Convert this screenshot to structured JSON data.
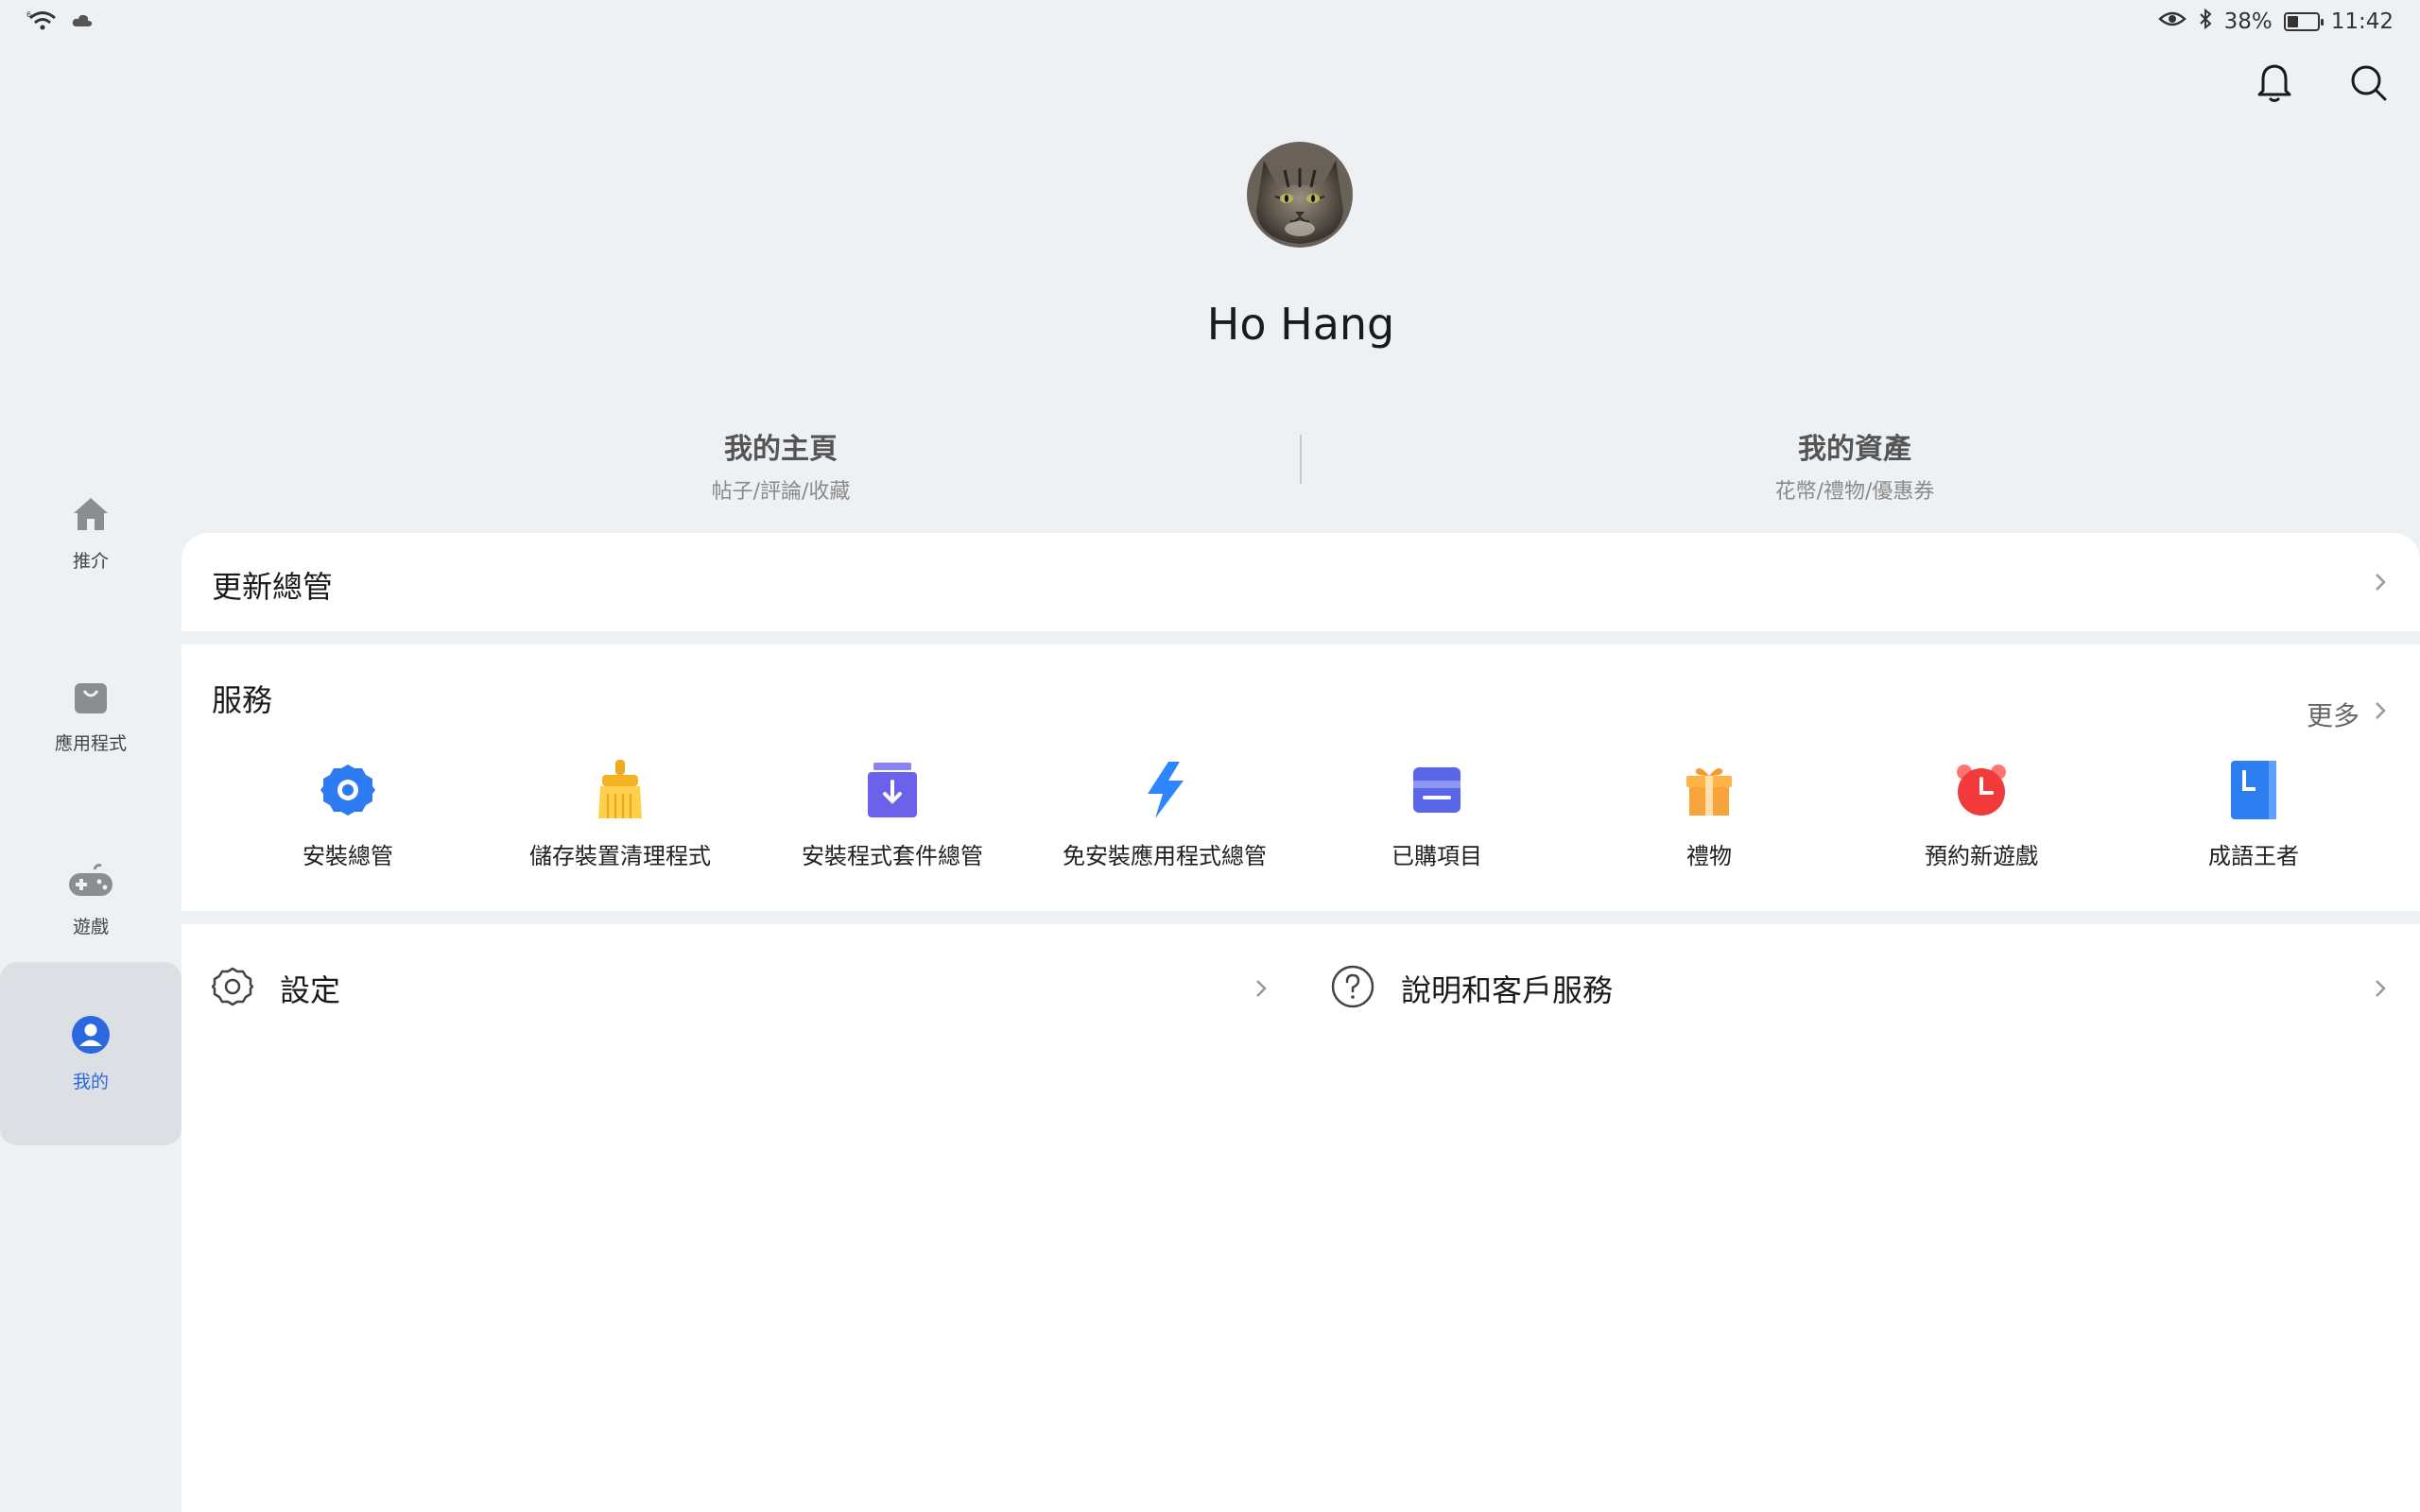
{
  "status_bar": {
    "battery": "38%",
    "battery_level": 0.38,
    "time": "11:42",
    "icons": [
      "wifi-icon",
      "cloud-icon",
      "eye-icon",
      "bluetooth-icon",
      "battery-icon"
    ]
  },
  "sidebar": {
    "items": [
      {
        "label": "推介",
        "icon": "home-icon",
        "active": false
      },
      {
        "label": "應用程式",
        "icon": "shopping-bag-icon",
        "active": false
      },
      {
        "label": "遊戲",
        "icon": "gamepad-icon",
        "active": false
      },
      {
        "label": "我的",
        "icon": "person-icon",
        "active": true
      }
    ]
  },
  "header": {
    "icons": [
      "bell-icon",
      "search-icon"
    ]
  },
  "profile": {
    "name": "Ho Hang"
  },
  "quick_links": [
    {
      "title": "我的主頁",
      "subtitle": "帖子/評論/收藏"
    },
    {
      "title": "我的資產",
      "subtitle": "花幣/禮物/優惠券"
    }
  ],
  "update_manager": {
    "label": "更新總管"
  },
  "services": {
    "title": "服務",
    "more": "更多",
    "items": [
      {
        "label": "安裝總管",
        "icon": "gear-icon"
      },
      {
        "label": "儲存裝置清理程式",
        "icon": "broom-icon"
      },
      {
        "label": "安裝程式套件總管",
        "icon": "package-download-icon"
      },
      {
        "label": "免安裝應用程式總管",
        "icon": "lightning-icon"
      },
      {
        "label": "已購項目",
        "icon": "wallet-icon"
      },
      {
        "label": "禮物",
        "icon": "gift-icon"
      },
      {
        "label": "預約新遊戲",
        "icon": "alarm-clock-icon"
      },
      {
        "label": "成語王者",
        "icon": "book-icon"
      }
    ]
  },
  "settings_row": [
    {
      "label": "設定",
      "icon": "settings-icon"
    },
    {
      "label": "說明和客戶服務",
      "icon": "help-icon"
    }
  ],
  "colors": {
    "accent": "#2b68e0",
    "background": "#eef1f4",
    "card": "#ffffff"
  }
}
